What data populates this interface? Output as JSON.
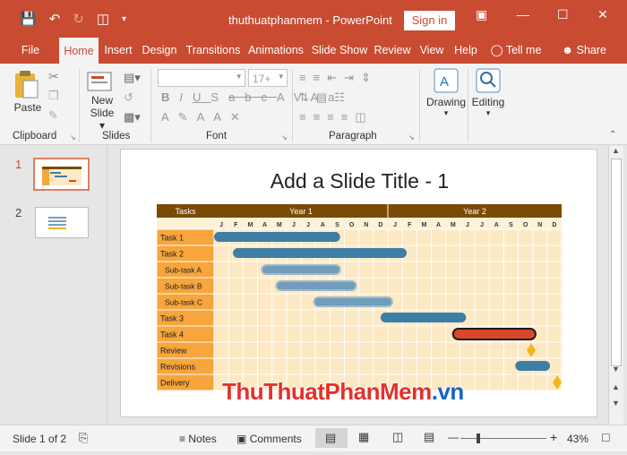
{
  "window": {
    "doc_title": "thuthuatphanmem",
    "app_name": "PowerPoint",
    "title_sep": "-",
    "signin": "Sign in"
  },
  "tabs": [
    "File",
    "Home",
    "Insert",
    "Design",
    "Transitions",
    "Animations",
    "Slide Show",
    "Review",
    "View",
    "Help",
    "Tell me",
    "Share"
  ],
  "ribbon": {
    "paste": "Paste",
    "new_slide_line1": "New",
    "new_slide_line2": "Slide",
    "font_size": "17+",
    "drawing": "Drawing",
    "editing": "Editing",
    "groups": [
      "Clipboard",
      "Slides",
      "Font",
      "Paragraph"
    ]
  },
  "thumbs": {
    "n1": "1",
    "n2": "2"
  },
  "slide": {
    "title": "Add a Slide Title - 1"
  },
  "gantt": {
    "header_tasks": "Tasks",
    "years": [
      "Year 1",
      "Year 2"
    ],
    "months": [
      "J",
      "F",
      "M",
      "A",
      "M",
      "J",
      "J",
      "A",
      "S",
      "O",
      "N",
      "D",
      "J",
      "F",
      "M",
      "A",
      "M",
      "J",
      "J",
      "A",
      "S",
      "O",
      "N",
      "D"
    ],
    "rows": [
      {
        "label": "Task 1",
        "indent": false,
        "start": 0,
        "end": 8.7,
        "kind": "task"
      },
      {
        "label": "Task 2",
        "indent": false,
        "start": 1.3,
        "end": 13.3,
        "kind": "task"
      },
      {
        "label": "Sub-task A",
        "indent": true,
        "start": 3.3,
        "end": 8.7,
        "kind": "sub"
      },
      {
        "label": "Sub-task B",
        "indent": true,
        "start": 4.3,
        "end": 9.8,
        "kind": "sub"
      },
      {
        "label": "Sub-task C",
        "indent": true,
        "start": 6.9,
        "end": 12.3,
        "kind": "sub"
      },
      {
        "label": "Task 3",
        "indent": false,
        "start": 11.5,
        "end": 17.4,
        "kind": "task"
      },
      {
        "label": "Task 4",
        "indent": false,
        "start": 16.5,
        "end": 22.2,
        "kind": "highlight"
      },
      {
        "label": "Review",
        "indent": false,
        "milestone": 22.4,
        "kind": "milestone"
      },
      {
        "label": "Revisions",
        "indent": false,
        "start": 20.8,
        "end": 23.2,
        "kind": "task"
      },
      {
        "label": "Delivery",
        "indent": false,
        "milestone": 24.2,
        "kind": "milestone"
      }
    ]
  },
  "watermark": {
    "part1": "ThuThuat",
    "part2": "PhanMem",
    "part3": ".vn"
  },
  "status": {
    "slide_info": "Slide 1 of 2",
    "notes": "Notes",
    "comments": "Comments",
    "zoom": "43%"
  },
  "colors": {
    "accent": "#c84b32",
    "bar": "#3d7ea6",
    "highlight_bar": "#d9472b",
    "milestone": "#f2b61b",
    "header_brown": "#7a4a06",
    "label_orange": "#f7a53c",
    "grid_bg": "#fde9c4"
  }
}
